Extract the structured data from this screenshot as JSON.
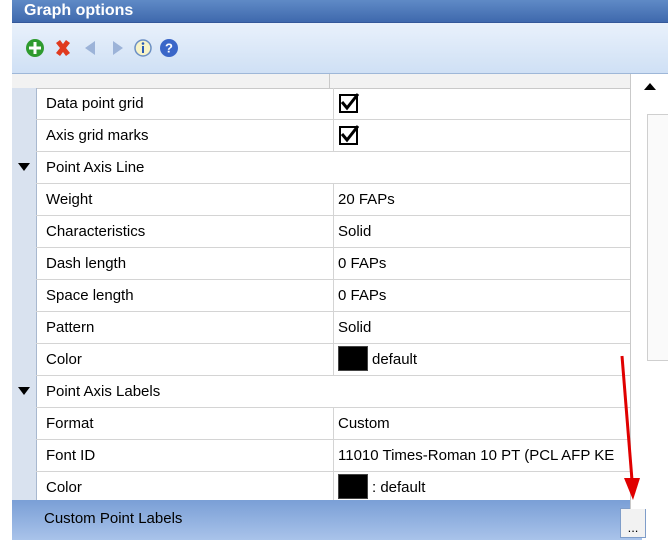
{
  "window": {
    "title": "Graph options"
  },
  "toolbar": {
    "icons": [
      "add-icon",
      "delete-icon",
      "back-icon",
      "forward-icon",
      "info-icon",
      "help-icon"
    ]
  },
  "rows": [
    {
      "type": "prop",
      "label": "Data point grid",
      "value_type": "checkbox",
      "checked": true
    },
    {
      "type": "prop",
      "label": "Axis grid marks",
      "value_type": "checkbox",
      "checked": true
    },
    {
      "type": "category",
      "label": "Point Axis Line"
    },
    {
      "type": "prop",
      "label": "Weight",
      "value": "20 FAPs"
    },
    {
      "type": "prop",
      "label": "Characteristics",
      "value": "Solid"
    },
    {
      "type": "prop",
      "label": "Dash length",
      "value": "0 FAPs"
    },
    {
      "type": "prop",
      "label": "Space length",
      "value": "0 FAPs"
    },
    {
      "type": "prop",
      "label": "Pattern",
      "value": "Solid"
    },
    {
      "type": "prop",
      "label": "Color",
      "value_type": "color",
      "value": "default",
      "color": "#000000"
    },
    {
      "type": "category",
      "label": "Point Axis Labels"
    },
    {
      "type": "prop",
      "label": "Format",
      "value": "Custom"
    },
    {
      "type": "prop",
      "label": "Font ID",
      "value": "11010 Times-Roman 10 PT (PCL AFP KE"
    },
    {
      "type": "prop",
      "label": "Color",
      "value_type": "color",
      "value": ": default",
      "color": "#000000"
    }
  ],
  "selected_row": {
    "label": "Custom Point Labels",
    "button_label": "..."
  },
  "annotation": {
    "color": "#e00000"
  }
}
